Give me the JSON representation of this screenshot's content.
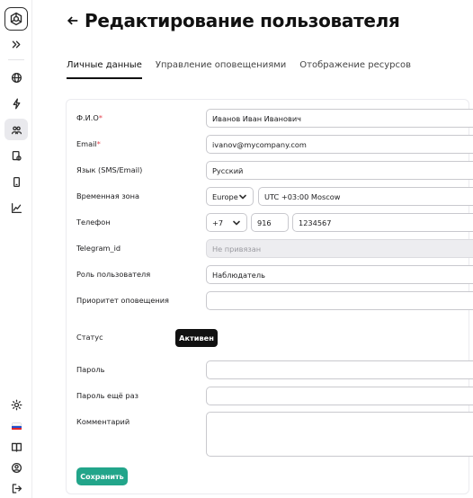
{
  "page": {
    "title": "Редактирование пользователя"
  },
  "tabs": [
    {
      "label": "Личные данные",
      "active": true
    },
    {
      "label": "Управление оповещениями",
      "active": false
    },
    {
      "label": "Отображение ресурсов",
      "active": false
    }
  ],
  "form": {
    "fio": {
      "label": "Ф.И.О",
      "required": "*",
      "value": "Иванов Иван Иванович"
    },
    "email": {
      "label": "Email",
      "required": "*",
      "value": "ivanov@mycompany.com"
    },
    "language": {
      "label": "Язык (SMS/Email)",
      "value": "Русский"
    },
    "timezone": {
      "label": "Временная зона",
      "region": "Europe",
      "zone": "UTC +03:00 Moscow"
    },
    "phone": {
      "label": "Телефон",
      "country_code": "+7",
      "area_code": "916",
      "number": "1234567"
    },
    "telegram": {
      "label": "Telegram_id",
      "placeholder": "Не привязан"
    },
    "role": {
      "label": "Роль пользователя",
      "value": "Наблюдатель"
    },
    "priority": {
      "label": "Приоритет оповещения",
      "value": ""
    },
    "status": {
      "label": "Статус",
      "value": "Активен"
    },
    "password": {
      "label": "Пароль",
      "value": ""
    },
    "password_repeat": {
      "label": "Пароль ещё раз",
      "value": ""
    },
    "comment": {
      "label": "Комментарий",
      "value": ""
    },
    "save_label": "Сохранить"
  },
  "sidebar": {
    "icons": [
      "logo-icon",
      "expand-icon",
      "globe-icon",
      "lightning-icon",
      "users-icon",
      "device-icon",
      "phone-icon",
      "chart-icon",
      "sun-icon",
      "flag-ru-icon",
      "book-icon",
      "user-circle-icon",
      "logout-icon"
    ]
  },
  "colors": {
    "accent": "#22a58a",
    "required": "#e4424e",
    "status_badge": "#111111"
  }
}
